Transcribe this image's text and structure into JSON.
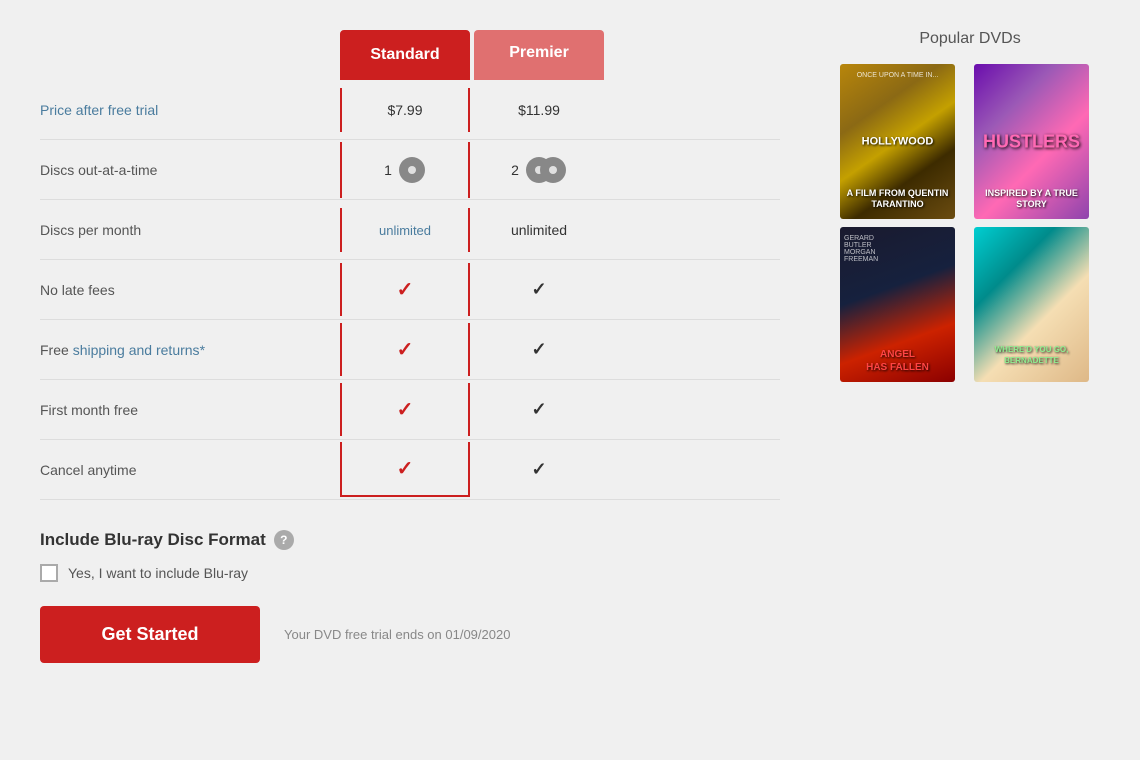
{
  "plans": {
    "standard": {
      "label": "Standard",
      "price": "$7.99",
      "discs_out": "1",
      "discs_per_month": "unlimited",
      "no_late_fees": true,
      "free_shipping": true,
      "first_month_free": true,
      "cancel_anytime": true
    },
    "premier": {
      "label": "Premier",
      "price": "$11.99",
      "discs_out": "2",
      "discs_per_month": "unlimited",
      "no_late_fees": true,
      "free_shipping": true,
      "first_month_free": true,
      "cancel_anytime": true
    }
  },
  "rows": [
    {
      "label": "Price after free trial",
      "id": "price"
    },
    {
      "label": "Discs out-at-a-time",
      "id": "discs_out"
    },
    {
      "label": "Discs per month",
      "id": "discs_per_month"
    },
    {
      "label": "No late fees",
      "id": "no_late_fees"
    },
    {
      "label": "Free shipping and returns*",
      "id": "free_shipping",
      "has_link": true
    },
    {
      "label": "First month free",
      "id": "first_month_free"
    },
    {
      "label": "Cancel anytime",
      "id": "cancel_anytime"
    }
  ],
  "bluray": {
    "title": "Include Blu-ray Disc Format",
    "checkbox_label": "Yes, I want to include Blu-ray",
    "help_tooltip": "?"
  },
  "cta": {
    "button_label": "Get Started",
    "trial_note": "Your DVD free trial ends on 01/09/2020"
  },
  "sidebar": {
    "title": "Popular DVDs",
    "movies": [
      {
        "title": "Once Upon a Time in Hollywood",
        "poster": "hollywood"
      },
      {
        "title": "Hustlers",
        "poster": "hustlers"
      },
      {
        "title": "Angel Has Fallen",
        "poster": "angel"
      },
      {
        "title": "Where'd You Go, Bernadette",
        "poster": "bernadette"
      }
    ]
  }
}
